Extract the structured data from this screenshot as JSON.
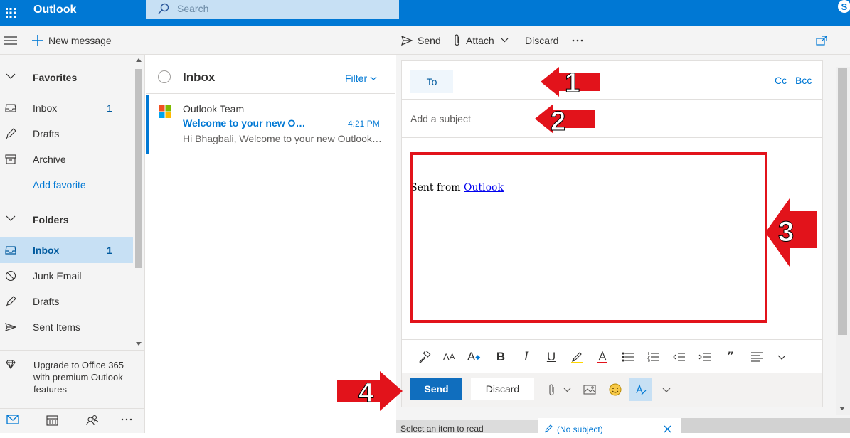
{
  "topbar": {
    "app_title": "Outlook",
    "search_placeholder": "Search"
  },
  "commands": {
    "new_message": "New message",
    "send": "Send",
    "attach": "Attach",
    "discard": "Discard"
  },
  "sidebar": {
    "favorites_label": "Favorites",
    "favorites": [
      {
        "label": "Inbox",
        "count": "1",
        "icon": "inbox-icon"
      },
      {
        "label": "Drafts",
        "icon": "pencil-icon"
      },
      {
        "label": "Archive",
        "icon": "archive-icon"
      }
    ],
    "add_favorite": "Add favorite",
    "folders_label": "Folders",
    "folders": [
      {
        "label": "Inbox",
        "count": "1",
        "icon": "inbox-icon",
        "selected": true
      },
      {
        "label": "Junk Email",
        "icon": "block-icon"
      },
      {
        "label": "Drafts",
        "icon": "pencil-icon"
      },
      {
        "label": "Sent Items",
        "icon": "send-icon"
      }
    ],
    "upgrade_text": "Upgrade to Office 365 with premium Outlook features"
  },
  "message_list": {
    "title": "Inbox",
    "filter_label": "Filter",
    "messages": [
      {
        "sender": "Outlook Team",
        "subject": "Welcome to your new Out...",
        "time": "4:21 PM",
        "preview": "Hi Bhagbali, Welcome to your new Outlook...."
      }
    ]
  },
  "compose": {
    "to_label": "To",
    "cc_label": "Cc",
    "bcc_label": "Bcc",
    "subject_placeholder": "Add a subject",
    "body_prefix": "Sent from ",
    "body_link": "Outlook",
    "send_label": "Send",
    "discard_label": "Discard"
  },
  "bottom_tabs": {
    "reading_pane": "Select an item to read",
    "draft_tab": "(No subject)"
  },
  "annotations": {
    "labels": [
      "1",
      "2",
      "3",
      "4"
    ],
    "color": "#e2131b"
  },
  "colors": {
    "brand": "#0078d4",
    "selected_bg": "#c7e0f4",
    "annotation": "#e2131b"
  }
}
